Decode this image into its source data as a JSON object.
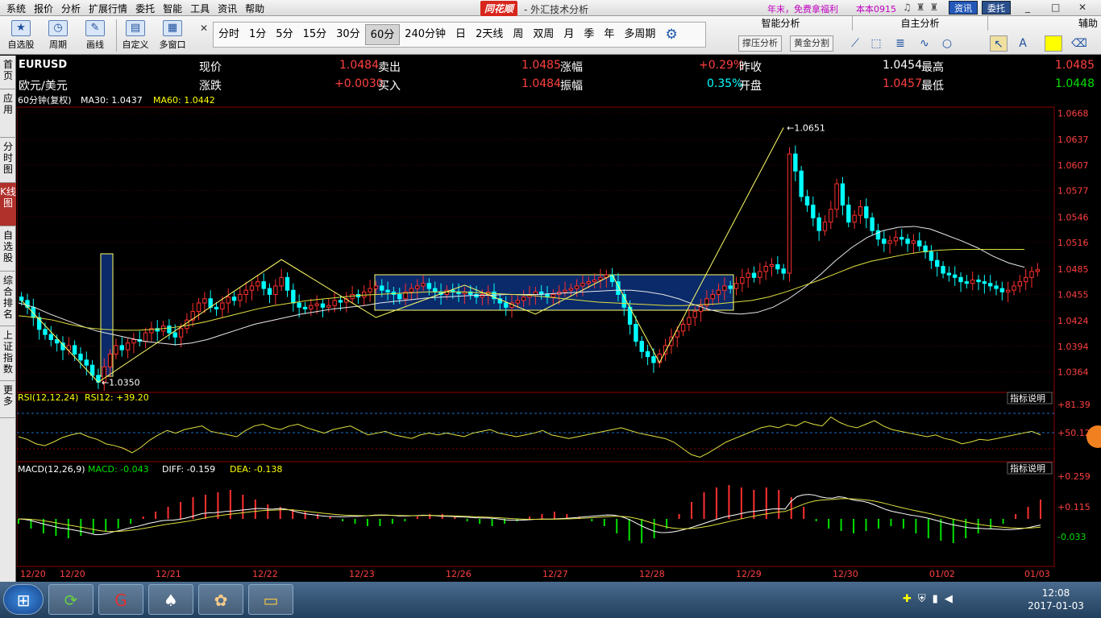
{
  "menu": {
    "items": [
      "系统",
      "报价",
      "分析",
      "扩展行情",
      "委托",
      "智能",
      "工具",
      "资讯",
      "帮助"
    ],
    "logo": "同花顺",
    "title": "- 外汇技术分析",
    "promo": "年末，免费拿福利",
    "version": "本本0915",
    "btn_news": "资讯",
    "btn_trade": "委托",
    "win_min": "_",
    "win_max": "□",
    "win_close": "✕"
  },
  "toolbar": {
    "buttons": [
      "自选股",
      "周期",
      "画线",
      "自定义",
      "多窗口"
    ],
    "periods": [
      "分时",
      "1分",
      "5分",
      "15分",
      "30分",
      "60分",
      "240分钟",
      "日",
      "2天线",
      "周",
      "双周",
      "月",
      "季",
      "年",
      "多周期"
    ],
    "active_period": "60分",
    "right_tabs": [
      "智能分析",
      "自主分析",
      "辅助"
    ],
    "smart_buttons": [
      "撑压分析",
      "黄金分割"
    ]
  },
  "left_tabs": [
    "首页",
    "应用",
    "分时图",
    "K线图",
    "自选股",
    "综合排名",
    "上证指数",
    "更多"
  ],
  "quote": {
    "symbol": "EURUSD",
    "name": "欧元/美元",
    "current_label": "现价",
    "current": "1.0484",
    "sell_label": "卖出",
    "sell": "1.0485",
    "change_pct_label": "涨幅",
    "change_pct": "+0.29%",
    "prev_close_label": "昨收",
    "prev_close": "1.0454",
    "high_label": "最高",
    "high": "1.0485",
    "change_label": "涨跌",
    "change": "+0.0030",
    "buy_label": "买入",
    "buy": "1.0484",
    "amplitude_label": "振幅",
    "amplitude": "0.35%",
    "open_label": "开盘",
    "open": "1.0457",
    "low_label": "最低",
    "low": "1.0448"
  },
  "main_indicator": {
    "period": "60分钟(复权)",
    "ma30": "MA30: 1.0437",
    "ma60": "MA60: 1.0442"
  },
  "rsi": {
    "label": "RSI(12,12,24)",
    "value": "RSI12: +39.20",
    "help": "指标说明",
    "ticks": [
      "+81.39",
      "+50.12"
    ]
  },
  "macd": {
    "label": "MACD(12,26,9)",
    "macd": "MACD: -0.043",
    "diff": "DIFF: -0.159",
    "dea": "DEA: -0.138",
    "help": "指标说明",
    "ticks": [
      "+0.259",
      "+0.115",
      "-0.033"
    ]
  },
  "chart_data": {
    "type": "candlestick",
    "y_ticks": [
      "1.0668",
      "1.0637",
      "1.0607",
      "1.0577",
      "1.0546",
      "1.0516",
      "1.0485",
      "1.0455",
      "1.0424",
      "1.0394",
      "1.0364"
    ],
    "ylim": [
      1.034,
      1.0675
    ],
    "x_labels": [
      "12/20",
      "12/20",
      "12/21",
      "12/22",
      "12/23",
      "12/26",
      "12/27",
      "12/28",
      "12/29",
      "12/30",
      "01/02",
      "01/03"
    ],
    "annotations": [
      {
        "text": "1.0651",
        "type": "high"
      },
      {
        "text": "1.0350",
        "type": "low"
      }
    ],
    "closes": [
      1.0448,
      1.044,
      1.0428,
      1.0414,
      1.0408,
      1.0402,
      1.0398,
      1.039,
      1.0395,
      1.0385,
      1.0378,
      1.0372,
      1.036,
      1.0352,
      1.037,
      1.0385,
      1.0395,
      1.039,
      1.0398,
      1.0402,
      1.04,
      1.041,
      1.0415,
      1.0412,
      1.0418,
      1.041,
      1.0405,
      1.0415,
      1.0425,
      1.0435,
      1.0445,
      1.045,
      1.044,
      1.0438,
      1.0445,
      1.0452,
      1.0448,
      1.0455,
      1.046,
      1.0465,
      1.047,
      1.0462,
      1.0455,
      1.0465,
      1.0475,
      1.046,
      1.0445,
      1.044,
      1.0438,
      1.0442,
      1.0444,
      1.044,
      1.0442,
      1.0448,
      1.0446,
      1.045,
      1.0455,
      1.0452,
      1.0458,
      1.0462,
      1.0465,
      1.046,
      1.0458,
      1.0455,
      1.045,
      1.0458,
      1.0462,
      1.0465,
      1.0468,
      1.0462,
      1.0458,
      1.0455,
      1.046,
      1.0458,
      1.0456,
      1.0458,
      1.0455,
      1.0452,
      1.0455,
      1.0458,
      1.045,
      1.0445,
      1.044,
      1.0445,
      1.0448,
      1.0452,
      1.0455,
      1.0458,
      1.0455,
      1.0452,
      1.0455,
      1.0458,
      1.046,
      1.0462,
      1.0465,
      1.0468,
      1.047,
      1.0472,
      1.0475,
      1.0478,
      1.047,
      1.0455,
      1.044,
      1.042,
      1.04,
      1.0388,
      1.0382,
      1.0375,
      1.0385,
      1.0395,
      1.0405,
      1.0412,
      1.042,
      1.0428,
      1.0435,
      1.0442,
      1.045,
      1.0455,
      1.046,
      1.0465,
      1.0462,
      1.0468,
      1.0475,
      1.048,
      1.0475,
      1.0482,
      1.0488,
      1.049,
      1.0485,
      1.048,
      1.062,
      1.06,
      1.057,
      1.056,
      1.0545,
      1.053,
      1.054,
      1.0555,
      1.0585,
      1.056,
      1.054,
      1.0548,
      1.0558,
      1.0545,
      1.053,
      1.052,
      1.0515,
      1.0518,
      1.0522,
      1.052,
      1.0515,
      1.0518,
      1.0512,
      1.0505,
      1.0495,
      1.0488,
      1.048,
      1.0478,
      1.0475,
      1.047,
      1.0468,
      1.0472,
      1.047,
      1.0468,
      1.0465,
      1.0462,
      1.0458,
      1.046,
      1.0465,
      1.047,
      1.0475,
      1.0482,
      1.0484
    ],
    "ma_white": [
      1.0445,
      1.044,
      1.0432,
      1.0425,
      1.0418,
      1.0412,
      1.0408,
      1.0404,
      1.04,
      1.0398,
      1.0396,
      1.0398,
      1.0402,
      1.0408,
      1.0414,
      1.042,
      1.0424,
      1.0428,
      1.0432,
      1.0435,
      1.0438,
      1.044,
      1.0442,
      1.0445,
      1.0447,
      1.0449,
      1.0451,
      1.0452,
      1.0453,
      1.0454,
      1.0454,
      1.0455,
      1.0455,
      1.0455,
      1.0456,
      1.0457,
      1.0458,
      1.0459,
      1.046,
      1.046,
      1.0458,
      1.0455,
      1.045,
      1.0443,
      1.0437,
      1.0433,
      1.0432,
      1.0434,
      1.044,
      1.045,
      1.0463,
      1.0478,
      1.0495,
      1.051,
      1.0522,
      1.053,
      1.0534,
      1.0535,
      1.0532,
      1.0525,
      1.0518,
      1.051,
      1.05,
      1.0492,
      1.0487
    ],
    "ma_yellow": [
      1.043,
      1.0428,
      1.0425,
      1.042,
      1.0416,
      1.0414,
      1.0413,
      1.0413,
      1.0414,
      1.0416,
      1.0419,
      1.0423,
      1.0428,
      1.0433,
      1.0438,
      1.0442,
      1.0445,
      1.0448,
      1.045,
      1.0452,
      1.0454,
      1.0455,
      1.0456,
      1.0457,
      1.0458,
      1.0458,
      1.0458,
      1.0457,
      1.0456,
      1.0455,
      1.0454,
      1.0452,
      1.045,
      1.0448,
      1.0446,
      1.0445,
      1.0444,
      1.0443,
      1.0442,
      1.0442,
      1.0443,
      1.0444,
      1.0446,
      1.0448,
      1.0452,
      1.0458,
      1.0465,
      1.0472,
      1.048,
      1.0488,
      1.0494,
      1.0498,
      1.0502,
      1.0505,
      1.0507,
      1.0508,
      1.0508,
      1.0508,
      1.0508,
      1.0508
    ],
    "zigzag": [
      [
        0,
        1.0448
      ],
      [
        13,
        1.0352
      ],
      [
        44,
        1.0496
      ],
      [
        60,
        1.0428
      ],
      [
        75,
        1.0466
      ],
      [
        87,
        1.0432
      ],
      [
        100,
        1.0478
      ],
      [
        108,
        1.0375
      ],
      [
        129,
        1.0651
      ]
    ],
    "rsi_values": [
      48,
      45,
      40,
      38,
      42,
      47,
      50,
      52,
      48,
      45,
      40,
      38,
      35,
      30,
      36,
      44,
      50,
      55,
      52,
      56,
      58,
      60,
      54,
      52,
      50,
      48,
      55,
      60,
      62,
      58,
      56,
      60,
      62,
      58,
      55,
      52,
      56,
      58,
      60,
      55,
      50,
      52,
      54,
      50,
      48,
      46,
      50,
      52,
      50,
      52,
      50,
      48,
      52,
      54,
      56,
      52,
      50,
      48,
      50,
      52,
      55,
      50,
      48,
      46,
      48,
      50,
      52,
      54,
      56,
      58,
      55,
      52,
      50,
      48,
      46,
      42,
      35,
      28,
      25,
      30,
      36,
      42,
      46,
      50,
      54,
      58,
      60,
      58,
      62,
      60,
      65,
      62,
      60,
      70,
      64,
      60,
      58,
      62,
      66,
      60,
      56,
      54,
      52,
      50,
      48,
      50,
      46,
      44,
      40,
      42,
      45,
      44,
      46,
      48,
      50,
      52,
      54,
      50
    ],
    "macd_bars": [
      -0.02,
      -0.04,
      -0.06,
      -0.07,
      -0.08,
      -0.07,
      -0.06,
      -0.05,
      -0.04,
      -0.02,
      0.01,
      0.03,
      0.05,
      0.07,
      0.09,
      0.1,
      0.11,
      0.12,
      0.1,
      0.08,
      0.06,
      0.05,
      0.04,
      0.03,
      0.02,
      0.01,
      -0.01,
      -0.02,
      -0.03,
      -0.03,
      -0.02,
      -0.01,
      0.01,
      0.02,
      0.02,
      0.01,
      -0.01,
      -0.02,
      -0.03,
      -0.02,
      -0.01,
      0.01,
      0.02,
      0.03,
      0.02,
      0.01,
      -0.01,
      -0.03,
      -0.06,
      -0.09,
      -0.1,
      -0.08,
      -0.04,
      0.02,
      0.07,
      0.11,
      0.13,
      0.14,
      0.13,
      0.12,
      0.13,
      0.12,
      0.09,
      0.05,
      -0.01,
      -0.04,
      -0.05,
      -0.06,
      -0.05,
      -0.04,
      -0.03,
      -0.04,
      -0.06,
      -0.08,
      -0.09,
      -0.1,
      -0.08,
      -0.06,
      -0.04,
      -0.02,
      0.02,
      0.05,
      0.08
    ]
  },
  "taskbar": {
    "time": "12:08",
    "date": "2017-01-03"
  }
}
